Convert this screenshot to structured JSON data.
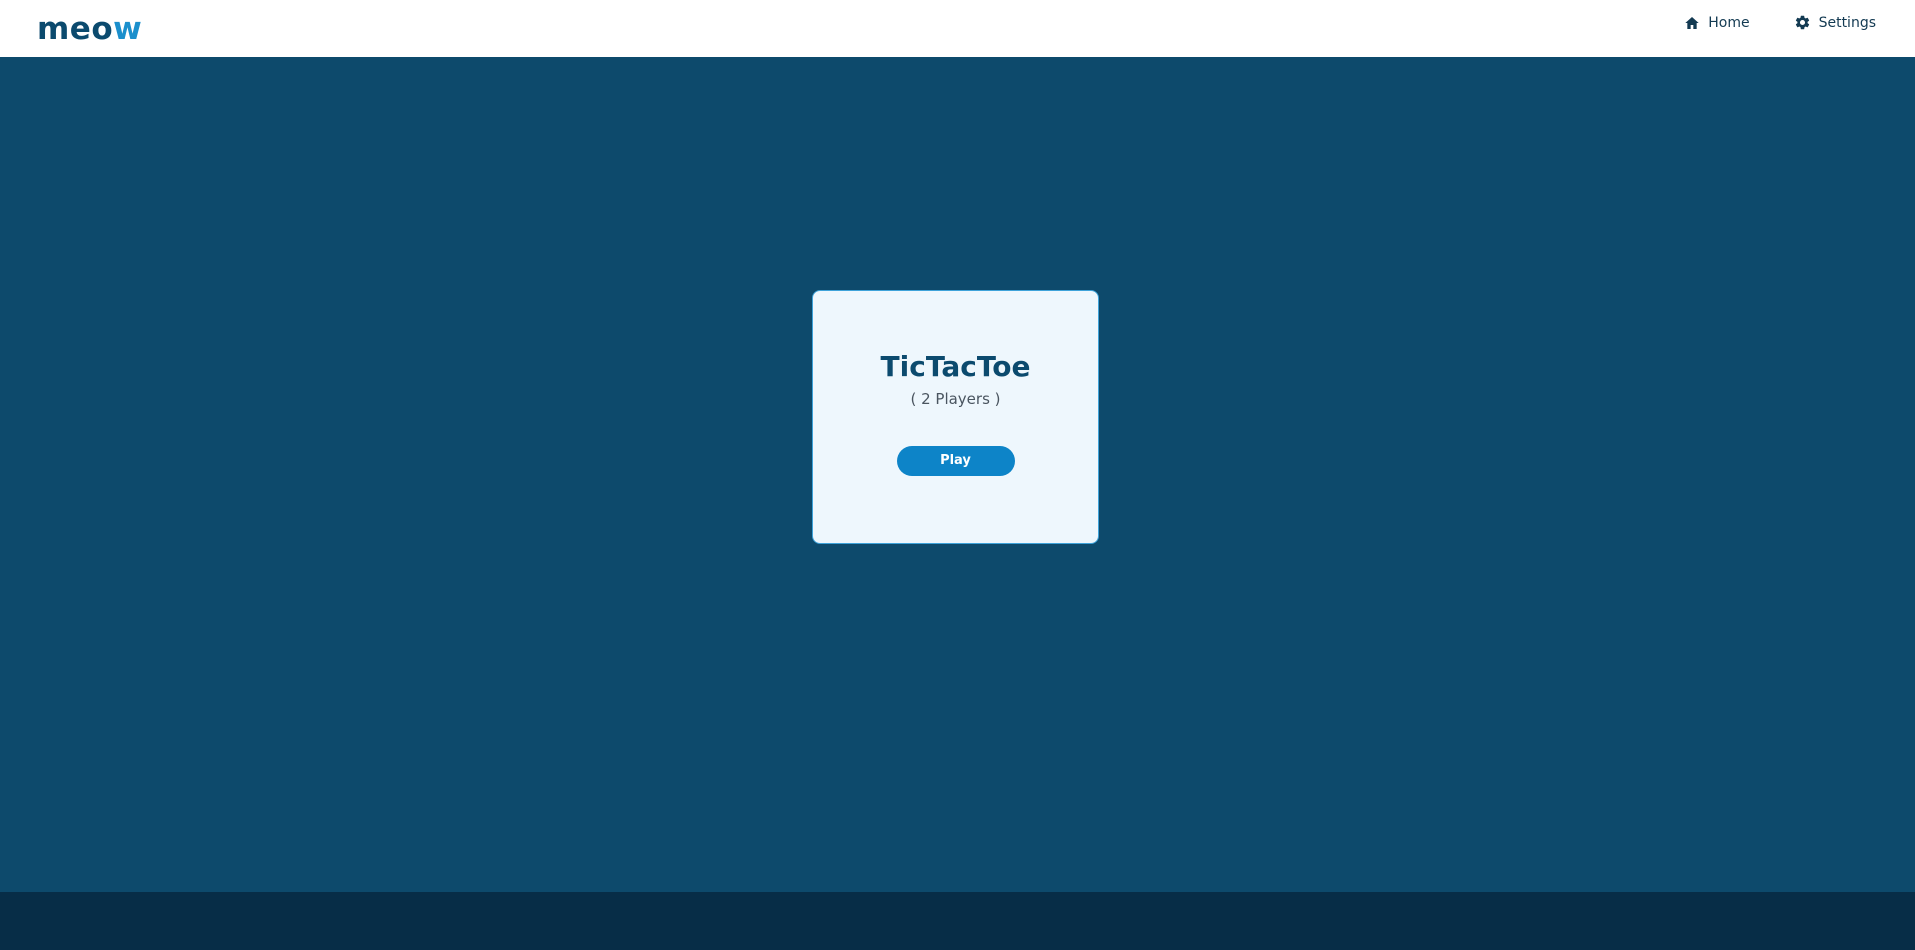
{
  "header": {
    "logo_part1": "meo",
    "logo_part2": "w",
    "nav": [
      {
        "label": "Home",
        "icon": "home-icon"
      },
      {
        "label": "Settings",
        "icon": "gear-icon"
      }
    ]
  },
  "game_card": {
    "title": "TicTacToe",
    "subtitle": "( 2 Players )",
    "play_label": "Play"
  },
  "colors": {
    "brand_dark": "#0b4a6e",
    "brand_light": "#1b8fcc",
    "main_background": "#0d4a6c",
    "footer_background": "#072d47",
    "button": "#0d84c8"
  }
}
